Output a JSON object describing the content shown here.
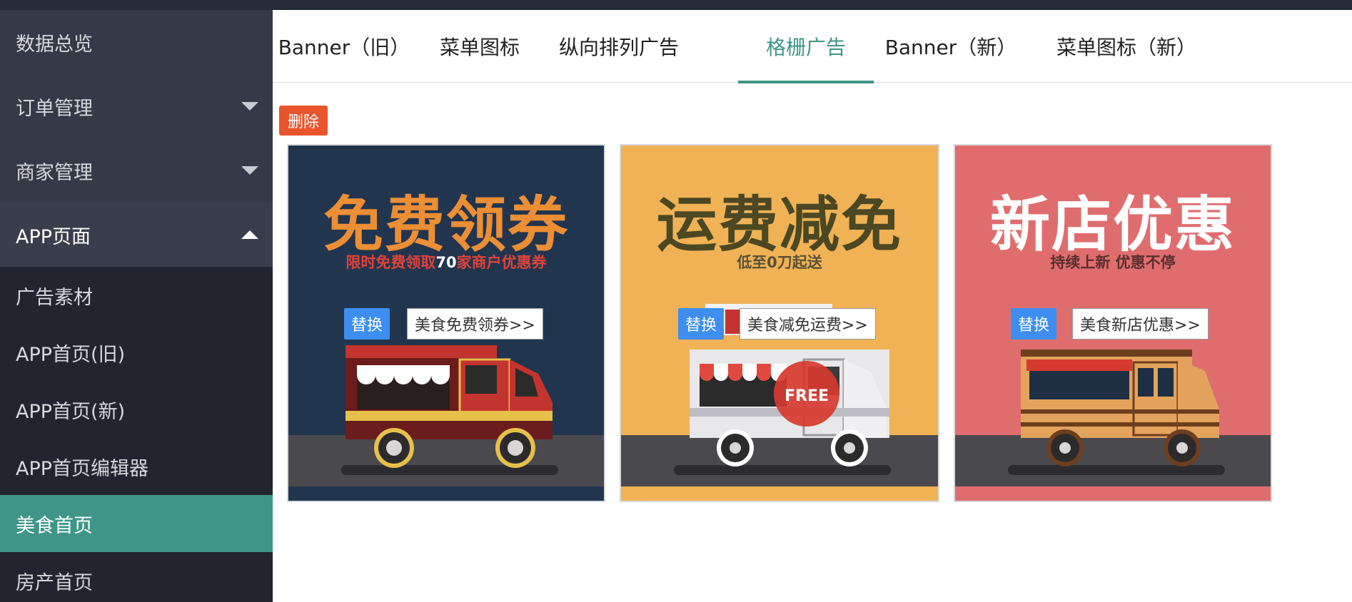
{
  "sidebar": {
    "groups": [
      {
        "label": "数据总览"
      },
      {
        "label": "订单管理"
      },
      {
        "label": "商家管理"
      },
      {
        "label": "APP页面"
      }
    ],
    "sub_items": [
      {
        "label": "广告素材"
      },
      {
        "label": "APP首页(旧)"
      },
      {
        "label": "APP首页(新)"
      },
      {
        "label": "APP首页编辑器"
      },
      {
        "label": "美食首页"
      },
      {
        "label": "房产首页"
      }
    ]
  },
  "tabs": [
    {
      "label": "Banner（旧）"
    },
    {
      "label": "菜单图标"
    },
    {
      "label": "纵向排列广告"
    },
    {
      "label": "格栅广告"
    },
    {
      "label": "Banner（新）"
    },
    {
      "label": "菜单图标（新）"
    }
  ],
  "toolbar": {
    "delete_label": "删除"
  },
  "cards": [
    {
      "title": "免费领券",
      "subtitle_a": "限时免费领取",
      "subtitle_num": "70",
      "subtitle_b": "家商户优惠券",
      "replace_label": "替换",
      "link_label": "美食免费领券>>",
      "bg": "#22354f",
      "title_color": "#ec8e34",
      "sub_color": "#e0433a"
    },
    {
      "title": "运费减免",
      "subtitle_a": "低至0刀起送",
      "replace_label": "替换",
      "link_label": "美食减免运费>>",
      "stamp_text": "FREE",
      "bg": "#f0b254",
      "title_color": "#4b4823",
      "sub_color": "#5a5236"
    },
    {
      "title": "新店优惠",
      "subtitle_a": "持续上新 优惠不停",
      "replace_label": "替换",
      "link_label": "美食新店优惠>>",
      "bg": "#e06d6e",
      "title_color": "#ffffff",
      "sub_color": "#5a2f2f"
    }
  ],
  "colors": {
    "accent": "#3f9686",
    "danger": "#e8542c",
    "primary": "#3d8ef0"
  }
}
